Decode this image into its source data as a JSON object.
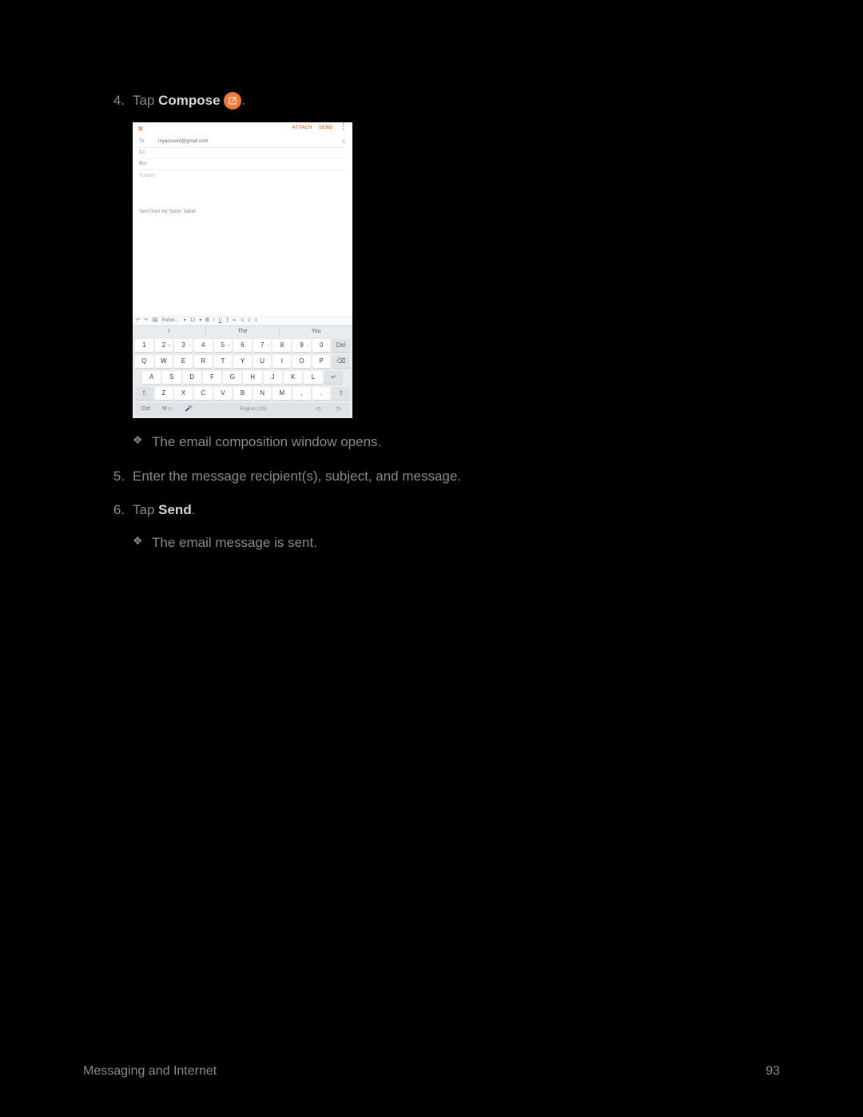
{
  "steps": {
    "s4": {
      "num": "4.",
      "prefix": "Tap ",
      "bold": "Compose",
      "suffix": " ",
      "tail": "."
    },
    "s4_sub": "The email composition window opens.",
    "s5": {
      "num": "5.",
      "text": "Enter the message recipient(s), subject, and message."
    },
    "s6": {
      "num": "6.",
      "prefix": "Tap ",
      "bold": "Send",
      "suffix": "."
    },
    "s6_sub": "The email message is sent."
  },
  "screenshot": {
    "attach": "ATTACH",
    "send": "SEND",
    "to_lbl": "To",
    "to_val": "myaccount@gmail.com",
    "cc": "Cc",
    "bcc": "Bcc",
    "subject": "Subject",
    "sig": "Sent from my Sprint Tablet.",
    "fmt_font": "Robot…",
    "fmt_size": "12",
    "sugg1": "I",
    "sugg2": "The",
    "sugg3": "You",
    "row1": [
      "1",
      "2",
      "3",
      "4",
      "5",
      "6",
      "7",
      "8",
      "9",
      "0",
      "Del"
    ],
    "row1_sup": [
      "",
      "@",
      "#",
      "?",
      "%",
      "",
      "&",
      "",
      "(",
      ")",
      ""
    ],
    "row2": [
      "Q",
      "W",
      "E",
      "R",
      "T",
      "Y",
      "U",
      "I",
      "O",
      "P",
      "⌫"
    ],
    "row3": [
      "A",
      "S",
      "D",
      "F",
      "G",
      "H",
      "J",
      "K",
      "L",
      "↵"
    ],
    "row4": [
      "⇧",
      "Z",
      "X",
      "C",
      "V",
      "B",
      "N",
      "M",
      ",",
      ".",
      "⇧"
    ],
    "row4_sup": [
      "",
      "",
      "",
      "",
      "",
      "",
      "",
      "",
      "!",
      "?",
      ""
    ],
    "bot": {
      "ctrl": "Ctrl",
      "sym": "!#☺",
      "mic": "🎤",
      "space": "English (US)",
      "left": "◁",
      "right": "▷"
    }
  },
  "footer": {
    "section": "Messaging and Internet",
    "page": "93"
  },
  "bullet": "❖"
}
